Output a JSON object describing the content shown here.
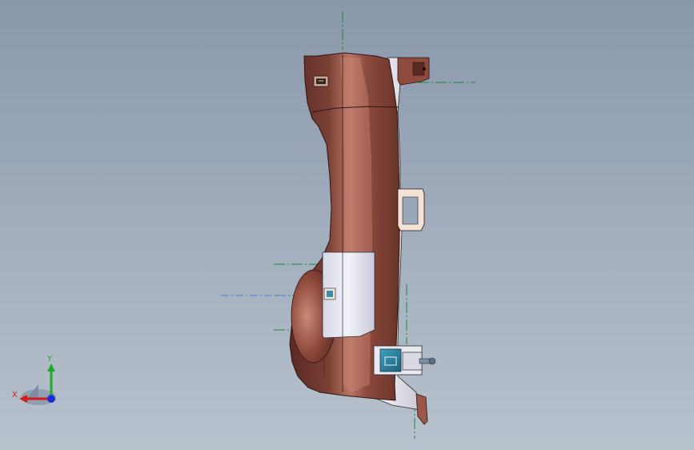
{
  "viewport": {
    "background_top": "#8a98ab",
    "background_bottom": "#b8c2cd"
  },
  "part": {
    "body_color": "#7a3f35",
    "highlight_color": "#c08070",
    "panel_color": "#ecedf4",
    "bracket_color": "#f3e2d6",
    "clip_color": "#2e7f9c"
  },
  "axes_triad": {
    "x_label": "X",
    "y_label": "Y",
    "x_color": "#d81a1a",
    "y_color": "#1faa2a",
    "z_color": "#1a2fd8"
  },
  "centerline_color": "#1a8a3a"
}
